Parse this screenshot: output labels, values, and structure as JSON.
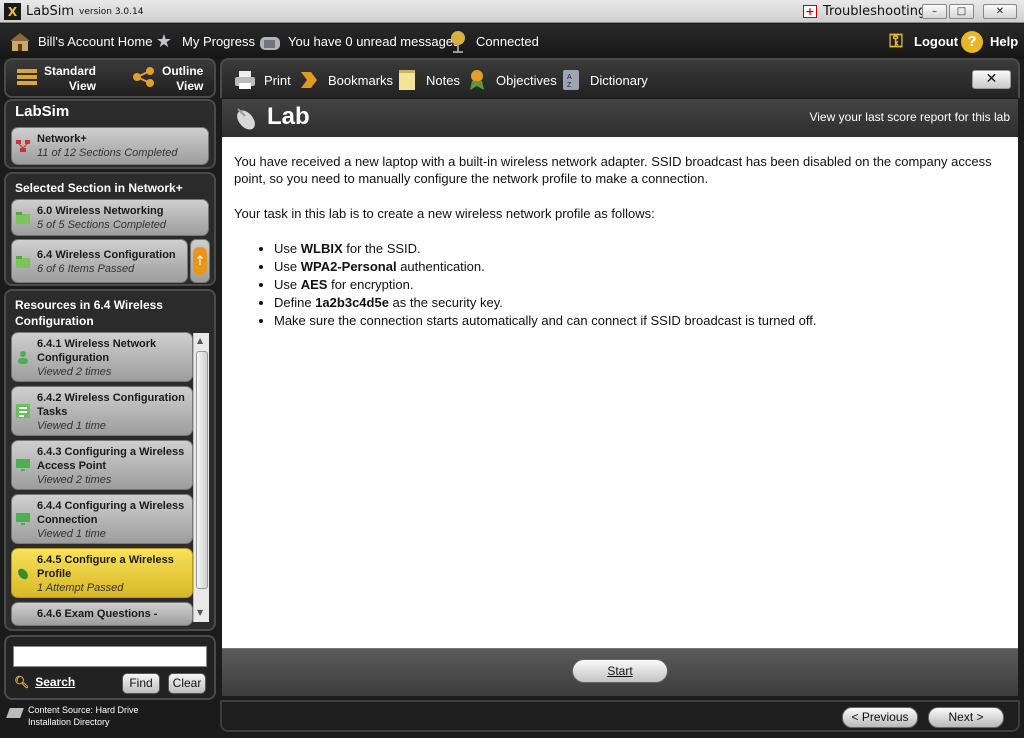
{
  "window": {
    "app_name": "LabSim",
    "version": "version 3.0.14",
    "troubleshooting": "Troubleshooting",
    "min": "–",
    "max": "□",
    "close": "✕"
  },
  "header": {
    "account_home": "Bill's Account Home",
    "my_progress": "My Progress",
    "messages": "You have 0 unread messages",
    "connection": "Connected",
    "logout": "Logout",
    "help": "Help"
  },
  "views": {
    "standard_line1": "Standard",
    "standard_line2": "View",
    "outline_line1": "Outline",
    "outline_line2": "View"
  },
  "sidebar": {
    "labsim_heading": "LabSim",
    "course": {
      "title": "Network+",
      "sub": "11 of 12 Sections Completed"
    },
    "selected_heading": "Selected Section in Network+",
    "section": {
      "title": "6.0 Wireless Networking",
      "sub": "5 of 5 Sections Completed"
    },
    "subsection": {
      "title": "6.4 Wireless Configuration",
      "sub": "6 of 6 Items Passed"
    },
    "resources_heading": "Resources in 6.4 Wireless Configuration",
    "resources": [
      {
        "title": "6.4.1 Wireless Network Configuration",
        "sub": "Viewed 2 times"
      },
      {
        "title": "6.4.2 Wireless Configuration Tasks",
        "sub": "Viewed 1 time"
      },
      {
        "title": "6.4.3 Configuring a Wireless Access Point",
        "sub": "Viewed 2 times"
      },
      {
        "title": "6.4.4 Configuring a Wireless Connection",
        "sub": "Viewed 1 time"
      },
      {
        "title": "6.4.5 Configure a Wireless Profile",
        "sub": "1 Attempt Passed"
      },
      {
        "title": "6.4.6 Exam Questions -",
        "sub": ""
      }
    ],
    "search_label": "Search",
    "find": "Find",
    "clear": "Clear",
    "content_source_line1": "Content Source: Hard Drive",
    "content_source_line2": "Installation Directory"
  },
  "toolbar": {
    "print": "Print",
    "bookmarks": "Bookmarks",
    "notes": "Notes",
    "objectives": "Objectives",
    "dictionary": "Dictionary",
    "close": "✕"
  },
  "lab": {
    "title": "Lab",
    "score_link": "View your last score report for this lab",
    "intro": "You have received a new laptop with a built-in wireless network adapter. SSID broadcast has been disabled on the company access point, so you need to manually configure the network profile to make a connection.",
    "task": "Your task in this lab is to create a new wireless network profile as follows:",
    "items": [
      {
        "pre": "Use ",
        "bold": "WLBIX",
        "post": " for the SSID."
      },
      {
        "pre": "Use ",
        "bold": "WPA2-Personal",
        "post": " authentication."
      },
      {
        "pre": "Use ",
        "bold": "AES",
        "post": " for encryption."
      },
      {
        "pre": "Define ",
        "bold": "1a2b3c4d5e",
        "post": " as the security key."
      },
      {
        "pre": "Make sure the connection starts automatically and can connect if SSID broadcast is turned off.",
        "bold": "",
        "post": ""
      }
    ],
    "start": "Start"
  },
  "nav": {
    "previous": "< Previous",
    "next": "Next >"
  }
}
